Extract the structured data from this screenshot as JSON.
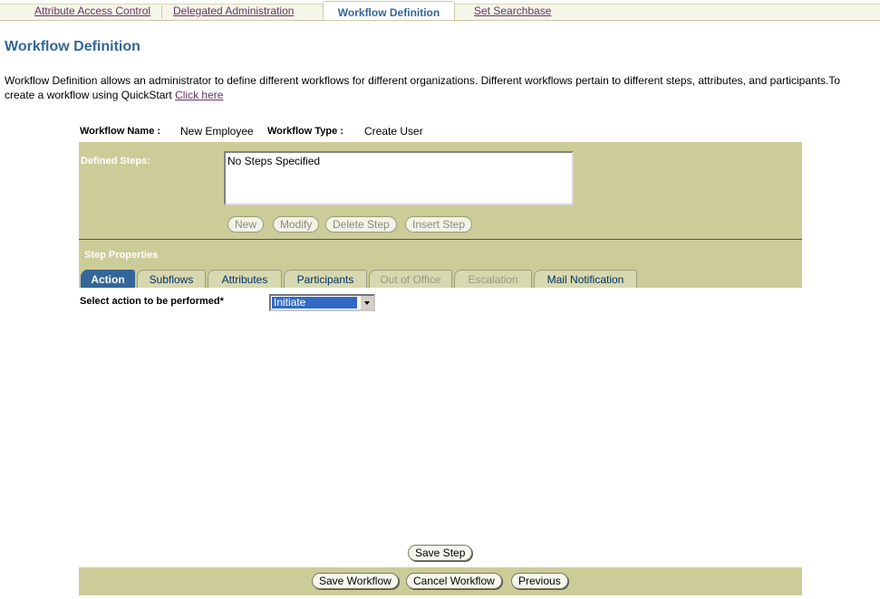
{
  "top_tabs": [
    {
      "label": "Attribute Access Control"
    },
    {
      "label": "Delegated Administration"
    },
    {
      "label": "Workflow Definition"
    },
    {
      "label": "Set Searchbase"
    }
  ],
  "page": {
    "title": "Workflow Definition",
    "description": "Workflow Definition allows an administrator to define different workflows for different organizations. Different workflows pertain to different steps, attributes, and participants.To create a workflow using QuickStart ",
    "quickstart_link": "Click here"
  },
  "workflow": {
    "name_label": "Workflow Name :",
    "name_value": "New Employee",
    "type_label": "Workflow Type :",
    "type_value": "Create User"
  },
  "defined_steps": {
    "label": "Defined Steps:",
    "list_value": "No Steps Specified",
    "buttons": {
      "new": "New",
      "modify": "Modify",
      "delete_step": "Delete Step",
      "insert_step": "Insert Step"
    }
  },
  "step_properties": {
    "title": "Step Properties",
    "tabs": {
      "action": "Action",
      "subflows": "Subflows",
      "attributes": "Attributes",
      "participants": "Participants",
      "out_of_office": "Out of Office",
      "escalation": "Escalation",
      "mail_notification": "Mail Notification"
    }
  },
  "action": {
    "label": "Select action to be performed*",
    "selected": "Initiate"
  },
  "buttons": {
    "save_step": "Save Step",
    "save_workflow": "Save Workflow",
    "cancel_workflow": "Cancel Workflow",
    "previous": "Previous"
  },
  "colors": {
    "panel": "#cccc99",
    "accent": "#336699",
    "link": "#663366"
  }
}
